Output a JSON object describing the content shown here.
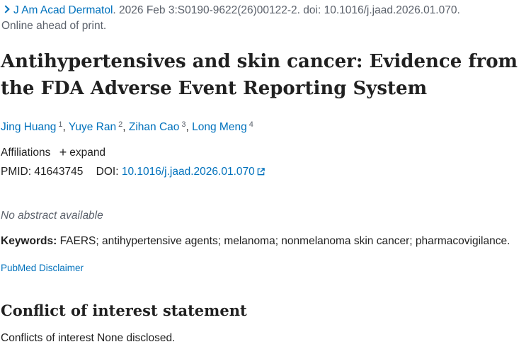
{
  "citation": {
    "journal": "J Am Acad Dermatol",
    "details": ". 2026 Feb 3:S0190-9622(26)00122-2. doi: 10.1016/j.jaad.2026.01.070.",
    "status": "Online ahead of print."
  },
  "article": {
    "title": "Antihypertensives and skin cancer: Evidence from the FDA Adverse Event Reporting System"
  },
  "authors": [
    {
      "name": "Jing Huang",
      "aff": "1"
    },
    {
      "name": "Yuye Ran",
      "aff": "2"
    },
    {
      "name": "Zihan Cao",
      "aff": "3"
    },
    {
      "name": "Long Meng",
      "aff": "4"
    }
  ],
  "affiliations": {
    "label": "Affiliations",
    "expand_label": "expand",
    "expand_symbol": "+"
  },
  "ids": {
    "pmid_label": "PMID:",
    "pmid": "41643745",
    "doi_label": "DOI:",
    "doi": "10.1016/j.jaad.2026.01.070"
  },
  "abstract": {
    "text": "No abstract available"
  },
  "keywords": {
    "label": "Keywords:",
    "text": "FAERS; antihypertensive agents; melanoma; nonmelanoma skin cancer; pharmacovigilance."
  },
  "disclaimer": {
    "label": "PubMed Disclaimer"
  },
  "conflict": {
    "heading": "Conflict of interest statement",
    "text": "Conflicts of interest None disclosed."
  },
  "colors": {
    "link": "#0071bc",
    "text": "#212121",
    "muted": "#5b616b"
  }
}
